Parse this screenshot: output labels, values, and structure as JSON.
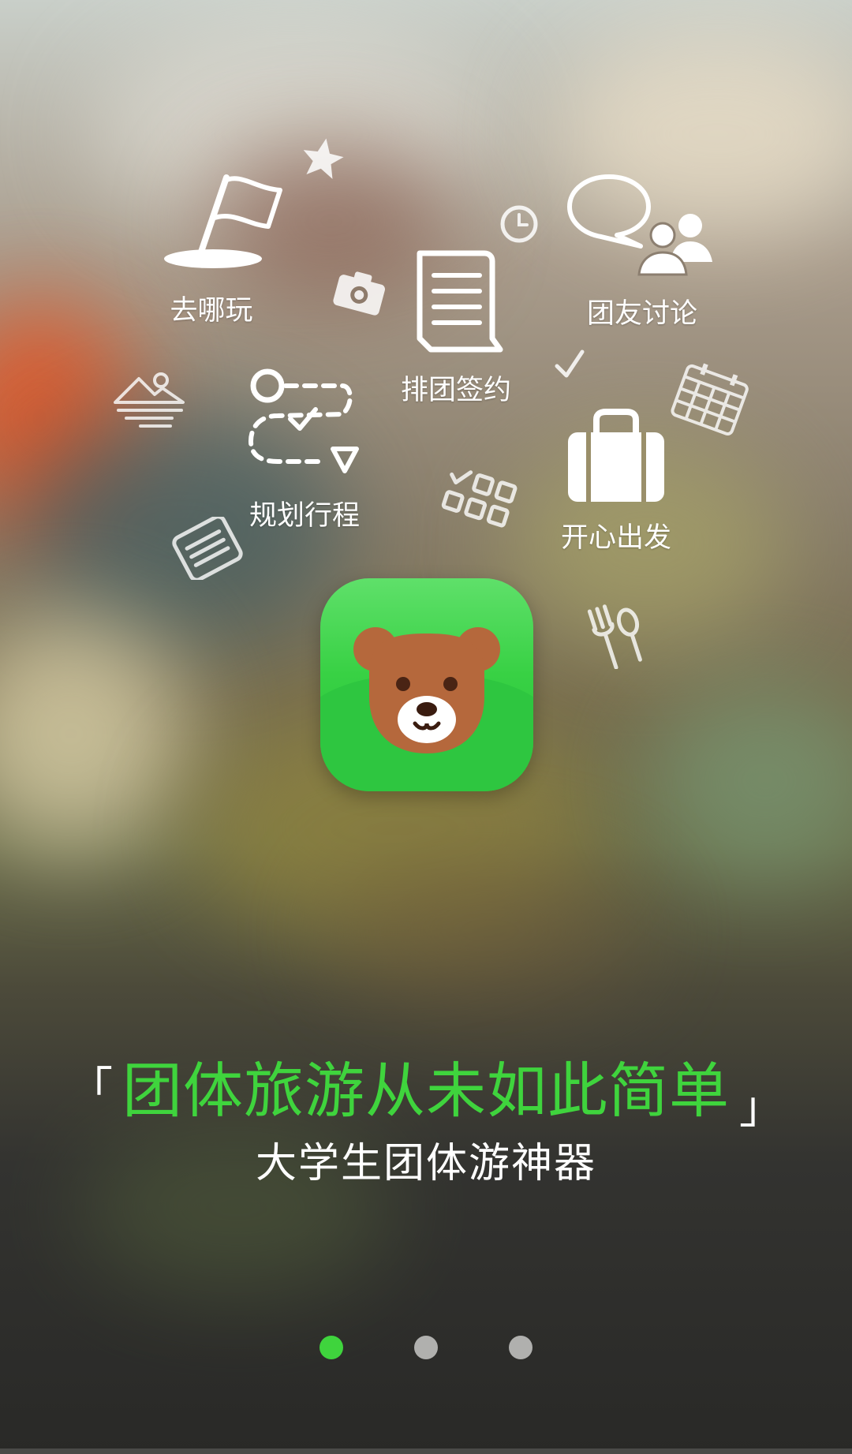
{
  "features": {
    "where_to_go": "去哪玩",
    "team_chat": "团友讨论",
    "sign_up": "排团签约",
    "plan_trip": "规划行程",
    "depart": "开心出发"
  },
  "icons": {
    "flag": "flag-icon",
    "star": "star-icon",
    "camera": "camera-icon",
    "clock": "clock-icon",
    "speech_bubble": "speech-bubble-icon",
    "people": "people-icon",
    "document": "document-icon",
    "check": "checkmark-icon",
    "calendar": "calendar-icon",
    "mountain": "mountain-icon",
    "route": "route-icon",
    "checklist": "checklist-icon",
    "suitcase": "suitcase-icon",
    "notes": "notes-icon",
    "utensils": "utensils-icon",
    "app_logo": "bear-logo-icon"
  },
  "slogan": {
    "open_quote": "「",
    "text": "团体旅游从未如此简单",
    "close_quote": "」"
  },
  "subtitle": "大学生团体游神器",
  "pagination": {
    "total": 3,
    "active": 1
  },
  "colors": {
    "accent": "#3fd43d",
    "dot_active": "#3fd43d",
    "dot_inactive": "#b0b0ae",
    "app_icon_green": "#38d144",
    "bear_brown": "#b5683c"
  }
}
